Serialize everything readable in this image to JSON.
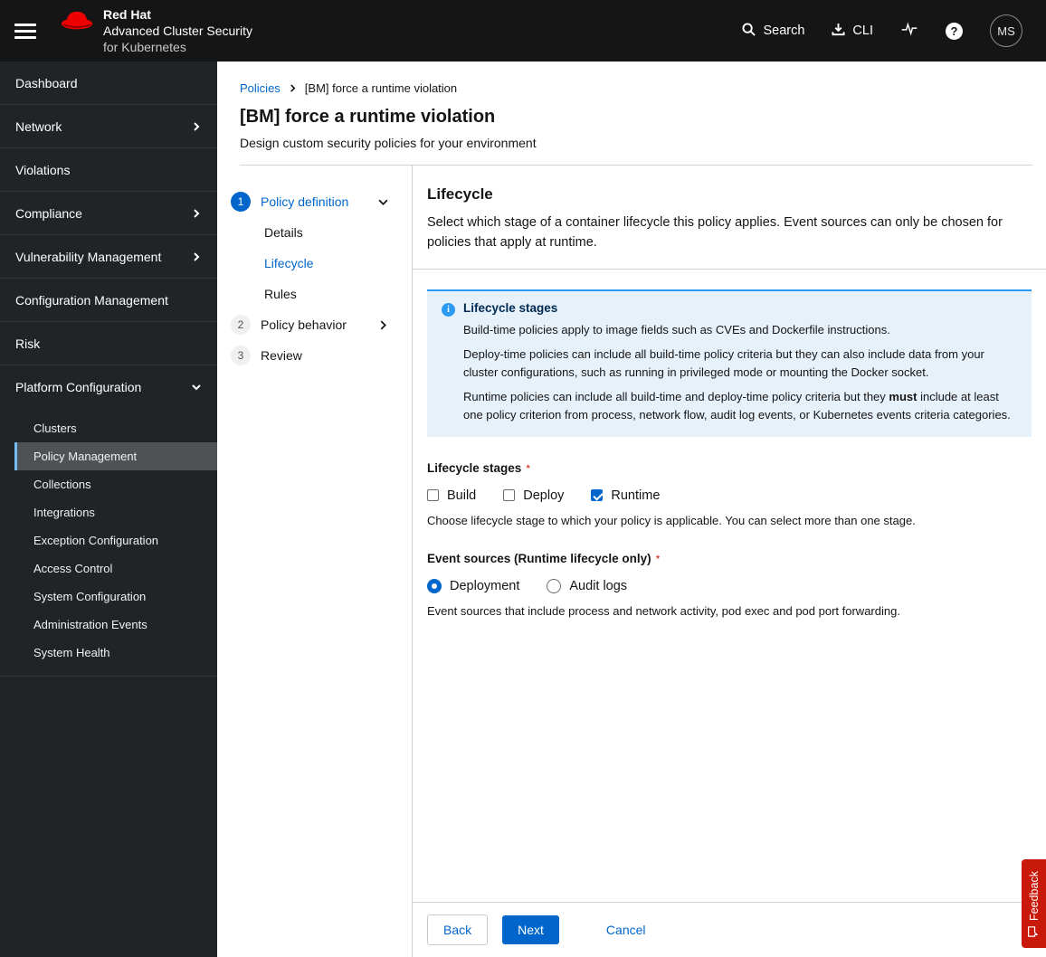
{
  "header": {
    "brand_line1": "Red Hat",
    "brand_line2": "Advanced Cluster Security",
    "brand_line3": "for Kubernetes",
    "search_label": "Search",
    "cli_label": "CLI",
    "avatar_initials": "MS"
  },
  "sidebar": {
    "items": [
      {
        "label": "Dashboard"
      },
      {
        "label": "Network",
        "chevron": "right"
      },
      {
        "label": "Violations"
      },
      {
        "label": "Compliance",
        "chevron": "right"
      },
      {
        "label": "Vulnerability Management",
        "chevron": "right"
      },
      {
        "label": "Configuration Management"
      },
      {
        "label": "Risk"
      },
      {
        "label": "Platform Configuration",
        "chevron": "down"
      }
    ],
    "platform_children": [
      {
        "label": "Clusters",
        "selected": false
      },
      {
        "label": "Policy Management",
        "selected": true
      },
      {
        "label": "Collections",
        "selected": false
      },
      {
        "label": "Integrations",
        "selected": false
      },
      {
        "label": "Exception Configuration",
        "selected": false
      },
      {
        "label": "Access Control",
        "selected": false
      },
      {
        "label": "System Configuration",
        "selected": false
      },
      {
        "label": "Administration Events",
        "selected": false
      },
      {
        "label": "System Health",
        "selected": false
      }
    ]
  },
  "breadcrumb": {
    "policies": "Policies",
    "current": "[BM] force a runtime violation"
  },
  "page": {
    "title": "[BM] force a runtime violation",
    "subtitle": "Design custom security policies for your environment"
  },
  "wizard": {
    "steps": [
      {
        "num": "1",
        "label": "Policy definition",
        "active": true
      },
      {
        "num": "2",
        "label": "Policy behavior",
        "active": false
      },
      {
        "num": "3",
        "label": "Review",
        "active": false
      }
    ],
    "step1_children": [
      {
        "label": "Details",
        "current": false
      },
      {
        "label": "Lifecycle",
        "current": true
      },
      {
        "label": "Rules",
        "current": false
      }
    ]
  },
  "content": {
    "heading": "Lifecycle",
    "description": "Select which stage of a container lifecycle this policy applies. Event sources can only be chosen for policies that apply at runtime.",
    "alert": {
      "title": "Lifecycle stages",
      "p1": "Build-time policies apply to image fields such as CVEs and Dockerfile instructions.",
      "p2": "Deploy-time policies can include all build-time policy criteria but they can also include data from your cluster configurations, such as running in privileged mode or mounting the Docker socket.",
      "p3_pre": "Runtime policies can include all build-time and deploy-time policy criteria but they ",
      "p3_bold": "must",
      "p3_post": " include at least one policy criterion from process, network flow, audit log events, or Kubernetes events criteria categories."
    },
    "lifecycle_stages": {
      "label": "Lifecycle stages",
      "required": "*",
      "options": [
        {
          "label": "Build",
          "checked": false
        },
        {
          "label": "Deploy",
          "checked": false
        },
        {
          "label": "Runtime",
          "checked": true
        }
      ],
      "helper": "Choose lifecycle stage to which your policy is applicable. You can select more than one stage."
    },
    "event_sources": {
      "label": "Event sources (Runtime lifecycle only)",
      "required": "*",
      "options": [
        {
          "label": "Deployment",
          "selected": true
        },
        {
          "label": "Audit logs",
          "selected": false
        }
      ],
      "helper": "Event sources that include process and network activity, pod exec and pod port forwarding."
    }
  },
  "footer": {
    "back": "Back",
    "next": "Next",
    "cancel": "Cancel"
  },
  "feedback": {
    "label": "Feedback"
  },
  "colors": {
    "accent_blue": "#0066cc",
    "info_blue": "#2b9af3",
    "selected_nav_border": "#73bcf7",
    "danger_red": "#c9190b",
    "brand_red": "#ee0000",
    "masthead_bg": "#151515",
    "sidebar_bg": "#212427"
  }
}
